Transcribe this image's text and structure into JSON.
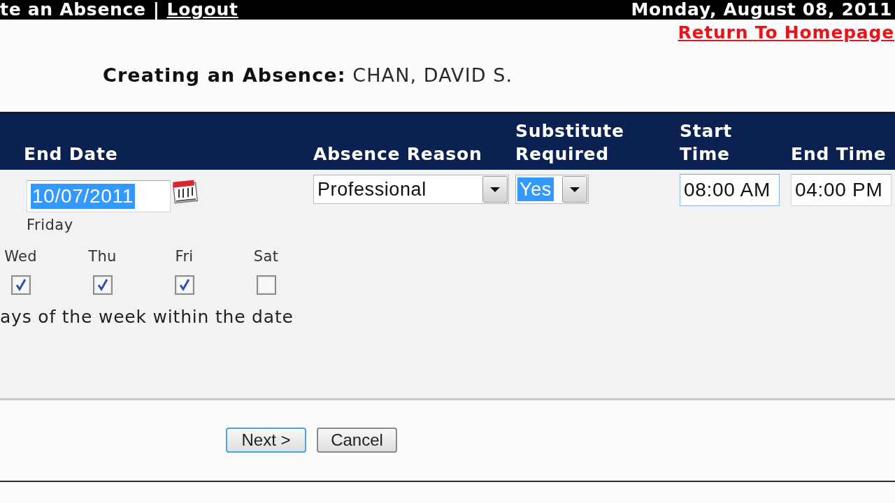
{
  "top_bar": {
    "page_title": "te an Absence",
    "separator": "|",
    "logout_link": "Logout",
    "date": "Monday, August 08, 2011"
  },
  "return_link": "Return To Homepage",
  "heading": "**Creating an Absence:** CHAN, DAVID S.",
  "form": {
    "columns": [
      "End Date",
      "Absence Reason",
      "Substitute Required",
      "Start Time",
      "End Time"
    ],
    "end_date": {
      "value": "10/07/2011",
      "highlighted": true,
      "weekday": "Friday"
    },
    "absence_reason": {
      "value": "Professional"
    },
    "substitute_required": {
      "value": "Yes",
      "highlighted": true
    },
    "start_time": {
      "value": "08:00 AM",
      "focused": true
    },
    "end_time": {
      "value": "04:00 PM",
      "focused": false
    },
    "days": [
      {
        "label": "Wed",
        "checked": true
      },
      {
        "label": "Thu",
        "checked": true
      },
      {
        "label": "Fri",
        "checked": true
      },
      {
        "label": "Sat",
        "checked": false
      }
    ],
    "days_note": "ays of the week within the date"
  },
  "buttons": [
    {
      "label": "Next >",
      "focused": true
    },
    {
      "label": "Cancel",
      "focused": false
    }
  ]
}
